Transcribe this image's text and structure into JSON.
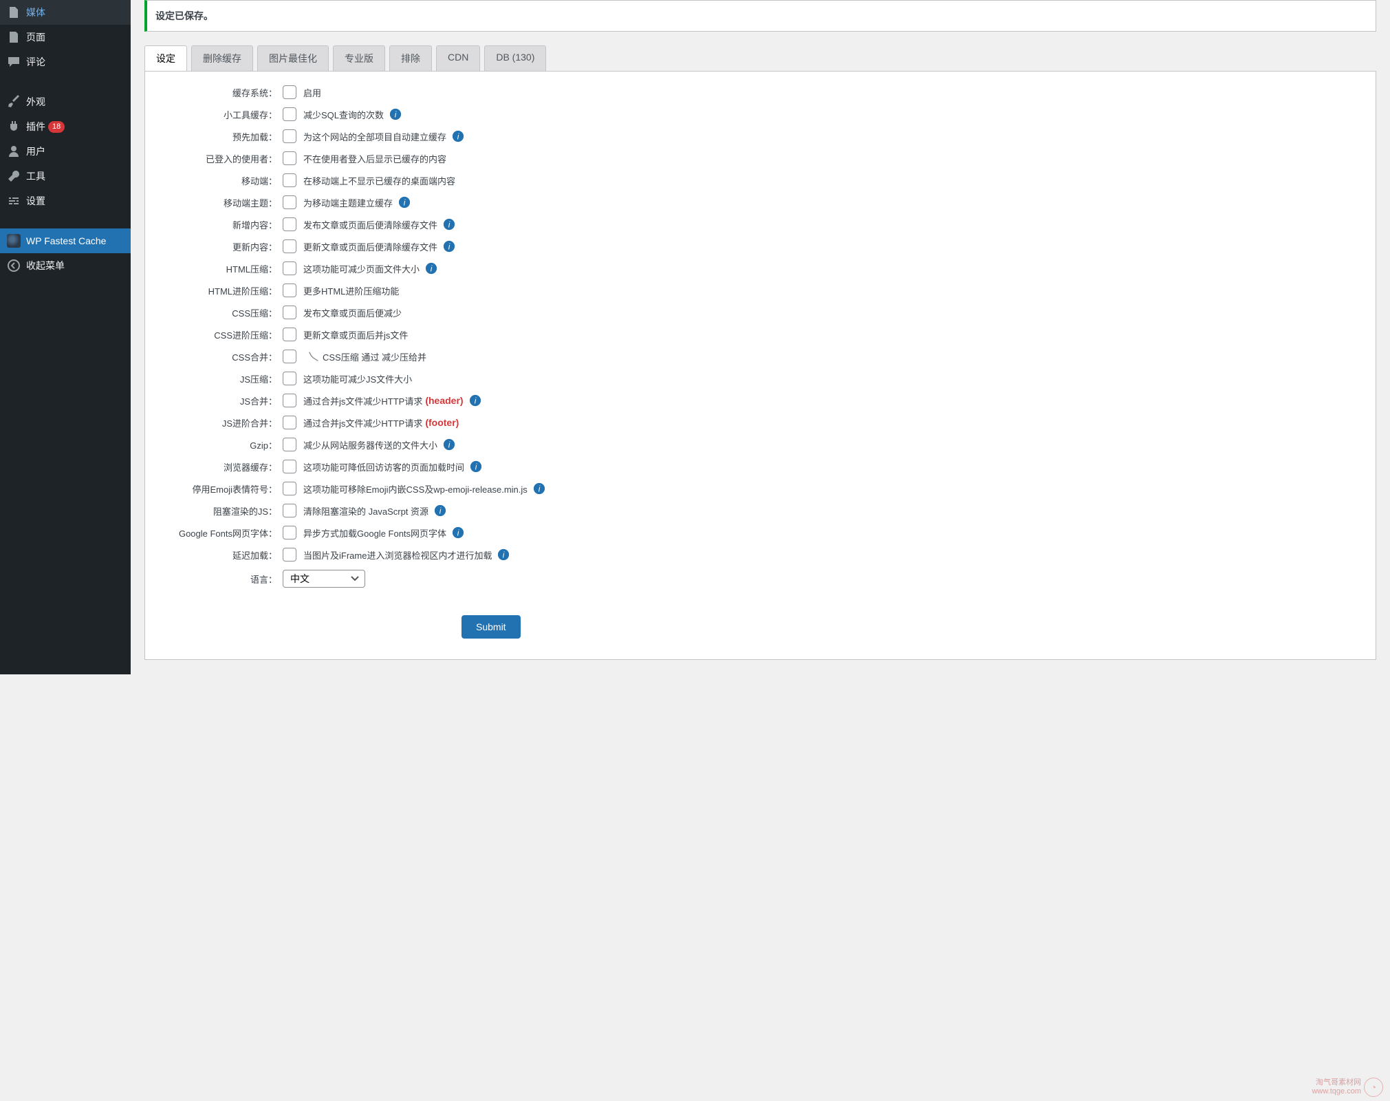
{
  "sidebar": {
    "items": [
      {
        "label": "媒体",
        "icon": "media"
      },
      {
        "label": "页面",
        "icon": "page"
      },
      {
        "label": "评论",
        "icon": "comment"
      },
      {
        "label": "外观",
        "icon": "brush"
      },
      {
        "label": "插件",
        "icon": "plugin",
        "badge": "18"
      },
      {
        "label": "用户",
        "icon": "user"
      },
      {
        "label": "工具",
        "icon": "tool"
      },
      {
        "label": "设置",
        "icon": "settings"
      },
      {
        "label": "WP Fastest Cache",
        "icon": "cheetah",
        "active": true
      },
      {
        "label": "收起菜单",
        "icon": "collapse"
      }
    ]
  },
  "notice": "设定已保存。",
  "tabs": [
    "设定",
    "删除缓存",
    "图片最佳化",
    "专业版",
    "排除",
    "CDN",
    "DB (130)"
  ],
  "active_tab": 0,
  "rows": [
    {
      "label": "缓存系统：",
      "desc": "启用",
      "info": false
    },
    {
      "label": "小工具缓存：",
      "desc": "减少SQL查询的次数",
      "info": true
    },
    {
      "label": "预先加载：",
      "desc": "为这个网站的全部项目自动建立缓存",
      "info": true
    },
    {
      "label": "已登入的使用者：",
      "desc": "不在使用者登入后显示已缓存的内容",
      "info": false
    },
    {
      "label": "移动端：",
      "desc": "在移动端上不显示已缓存的桌面端内容",
      "info": false
    },
    {
      "label": "移动端主题：",
      "desc": "为移动端主题建立缓存",
      "info": true
    },
    {
      "label": "新增内容：",
      "desc": "发布文章或页面后便清除缓存文件",
      "info": true
    },
    {
      "label": "更新内容：",
      "desc": "更新文章或页面后便清除缓存文件",
      "info": true
    },
    {
      "label": "HTML压缩：",
      "desc": "这项功能可减少页面文件大小",
      "info": true
    },
    {
      "label": "HTML进阶压缩：",
      "desc": "更多HTML进阶压缩功能",
      "info": false
    },
    {
      "label": "CSS压缩：",
      "desc": "发布文章或页面后便减少",
      "info": false
    },
    {
      "label": "CSS进阶压缩：",
      "desc": "更新文章或页面后并js文件",
      "info": false
    },
    {
      "label": "CSS合并：",
      "desc": "CSS压缩 通过 减少压给并",
      "info": false,
      "excl": true
    },
    {
      "label": "JS压缩：",
      "desc": "这项功能可减少JS文件大小",
      "info": false
    },
    {
      "label": "JS合并：",
      "desc": "通过合并js文件减少HTTP请求",
      "info": true,
      "hl": "(header)"
    },
    {
      "label": "JS进阶合并：",
      "desc": "通过合并js文件减少HTTP请求",
      "info": false,
      "hl": "(footer)"
    },
    {
      "label": "Gzip：",
      "desc": "减少从网站服务器传送的文件大小",
      "info": true
    },
    {
      "label": "浏览器缓存：",
      "desc": "这项功能可降低回访访客的页面加载时间",
      "info": true
    },
    {
      "label": "停用Emoji表情符号：",
      "desc": "这项功能可移除Emoji内嵌CSS及wp-emoji-release.min.js",
      "info": true
    },
    {
      "label": "阻塞渲染的JS：",
      "desc": "清除阻塞渲染的 JavaScrpt 资源",
      "info": true
    },
    {
      "label": "Google Fonts网页字体：",
      "desc": "异步方式加载Google Fonts网页字体",
      "info": true
    },
    {
      "label": "延迟加载：",
      "desc": "当图片及iFrame进入浏览器检视区内才进行加载",
      "info": true
    }
  ],
  "lang_label": "语言：",
  "lang_value": "中文",
  "submit": "Submit",
  "watermark": {
    "line1": "淘气哥素材网",
    "line2": "www.tqge.com"
  }
}
